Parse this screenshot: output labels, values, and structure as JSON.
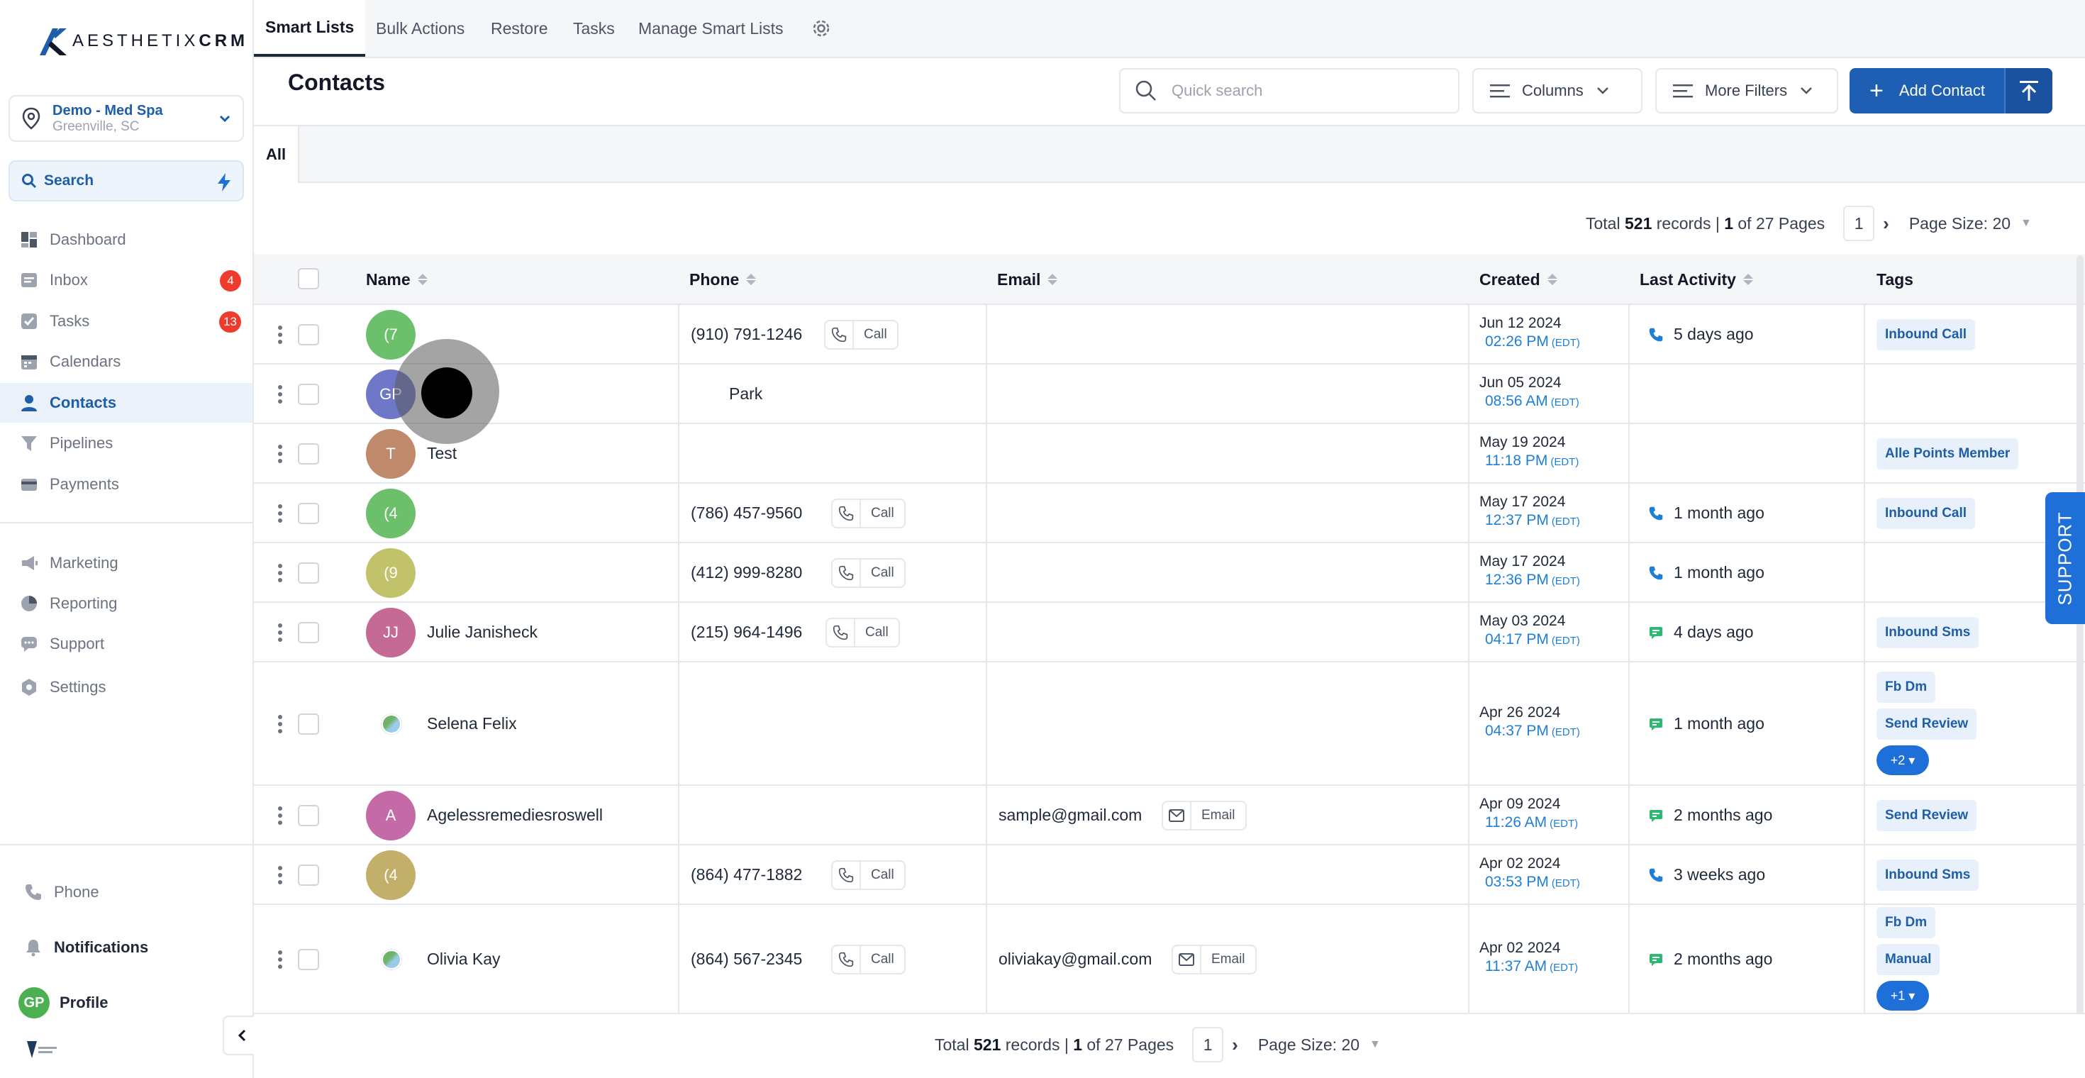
{
  "app": {
    "logo_prefix": "AESTHETIX",
    "logo_suffix": "CRM",
    "location_name": "Demo - Med Spa",
    "location_city": "Greenville, SC",
    "search_label": "Search"
  },
  "sidebar": {
    "items": [
      {
        "label": "Dashboard",
        "icon": "dashboard-icon"
      },
      {
        "label": "Inbox",
        "icon": "inbox-icon",
        "badge": "4"
      },
      {
        "label": "Tasks",
        "icon": "tasks-icon",
        "badge": "13"
      },
      {
        "label": "Calendars",
        "icon": "calendar-icon"
      },
      {
        "label": "Contacts",
        "icon": "contacts-icon",
        "active": true
      },
      {
        "label": "Pipelines",
        "icon": "pipeline-icon"
      },
      {
        "label": "Payments",
        "icon": "payments-icon"
      }
    ],
    "items2": [
      {
        "label": "Marketing",
        "icon": "megaphone-icon"
      },
      {
        "label": "Reporting",
        "icon": "pie-chart-icon"
      },
      {
        "label": "Support",
        "icon": "chat-icon"
      },
      {
        "label": "Settings",
        "icon": "gear-icon"
      }
    ],
    "bottom": {
      "phone": "Phone",
      "notifications": "Notifications",
      "profile": "Profile",
      "profile_initials": "GP"
    }
  },
  "topnav": {
    "tabs": [
      "Smart Lists",
      "Bulk Actions",
      "Restore",
      "Tasks",
      "Manage Smart Lists"
    ]
  },
  "header": {
    "title": "Contacts",
    "search_placeholder": "Quick search",
    "columns_label": "Columns",
    "more_filters_label": "More Filters",
    "add_contact_label": "Add Contact"
  },
  "list_tabs": [
    "All"
  ],
  "pagination": {
    "total_prefix": "Total",
    "total": "521",
    "records_text": "records |",
    "page": "1",
    "of_pages": "of 27 Pages",
    "current_page": "1",
    "page_size": "Page Size: 20"
  },
  "table": {
    "columns": [
      "Name",
      "Phone",
      "Email",
      "Created",
      "Last Activity",
      "Tags"
    ],
    "rows": [
      {
        "initials": "(7",
        "color": "#6cbf6b",
        "name": "",
        "phone": "(910) 791-1246",
        "email": "",
        "date": "Jun 12 2024",
        "time": "02:26 PM",
        "activity": "5 days ago",
        "activity_type": "call",
        "tags": [
          "Inbound Call"
        ]
      },
      {
        "initials": "GP",
        "color": "#6f78c8",
        "name": "Park",
        "phone": "",
        "email": "",
        "date": "Jun 05 2024",
        "time": "08:56 AM",
        "activity": "",
        "activity_type": "",
        "tags": []
      },
      {
        "initials": "T",
        "color": "#bf8a6c",
        "name": "Test",
        "phone": "",
        "email": "",
        "date": "May 19 2024",
        "time": "11:18 PM",
        "activity": "",
        "activity_type": "",
        "tags": [
          "Alle Points Member"
        ]
      },
      {
        "initials": "(4",
        "color": "#6cbf6b",
        "name": "",
        "phone": "(786) 457-9560",
        "email": "",
        "date": "May 17 2024",
        "time": "12:37 PM",
        "activity": "1 month ago",
        "activity_type": "call",
        "tags": [
          "Inbound Call"
        ]
      },
      {
        "initials": "(9",
        "color": "#c2c26a",
        "name": "",
        "phone": "(412) 999-8280",
        "email": "",
        "date": "May 17 2024",
        "time": "12:36 PM",
        "activity": "1 month ago",
        "activity_type": "call",
        "tags": []
      },
      {
        "initials": "JJ",
        "color": "#c46a94",
        "name": "Julie Janisheck",
        "phone": "(215) 964-1496",
        "email": "",
        "date": "May 03 2024",
        "time": "04:17 PM",
        "activity": "4 days ago",
        "activity_type": "sms",
        "tags": [
          "Inbound Sms"
        ]
      },
      {
        "initials": "",
        "color": "",
        "name": "Selena Felix",
        "phone": "",
        "email": "",
        "date": "Apr 26 2024",
        "time": "04:37 PM",
        "activity": "1 month ago",
        "activity_type": "sms",
        "tags": [
          "Fb Dm",
          "Send Review"
        ],
        "more": "+2"
      },
      {
        "initials": "A",
        "color": "#c46aa6",
        "name": "Agelessremediesroswell",
        "phone": "",
        "email": "sample@gmail.com",
        "date": "Apr 09 2024",
        "time": "11:26 AM",
        "activity": "2 months ago",
        "activity_type": "sms",
        "tags": [
          "Send Review"
        ]
      },
      {
        "initials": "(4",
        "color": "#c2b06a",
        "name": "",
        "phone": "(864) 477-1882",
        "email": "",
        "date": "Apr 02 2024",
        "time": "03:53 PM",
        "activity": "3 weeks ago",
        "activity_type": "call",
        "tags": [
          "Inbound Sms"
        ]
      },
      {
        "initials": "",
        "color": "",
        "name": "Olivia Kay",
        "phone": "(864) 567-2345",
        "email": "oliviakay@gmail.com",
        "date": "Apr 02 2024",
        "time": "11:37 AM",
        "activity": "2 months ago",
        "activity_type": "sms",
        "tags": [
          "Fb Dm",
          "Manual"
        ],
        "more": "+1"
      }
    ],
    "call_label": "Call",
    "email_label": "Email",
    "tz": "(EDT)"
  },
  "support_label": "SUPPORT",
  "colors": {
    "brand": "#1e5fb4",
    "accent_link": "#1e7fd6",
    "badge_red": "#ef3b2d",
    "sms_green": "#2eb872"
  }
}
